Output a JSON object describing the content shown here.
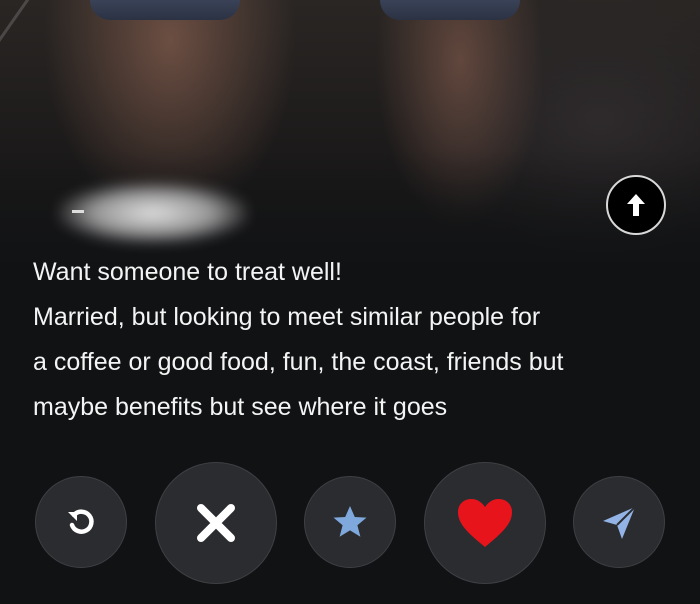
{
  "profile": {
    "name_redacted": true,
    "bio_lines": [
      "Want someone to treat well!",
      "Married,  but looking to meet similar people for",
      "a coffee or good food, fun, the coast, friends but",
      "maybe benefits but see where it goes"
    ]
  },
  "buttons": {
    "info": "arrow-up-icon",
    "rewind": "rewind-icon",
    "nope": "close-icon",
    "super_like": "star-icon",
    "like": "heart-icon",
    "boost": "send-arrow-icon"
  },
  "colors": {
    "nope": "#ffffff",
    "super_like": "#7fa8dd",
    "like": "#e8141c",
    "boost": "#93b3e6"
  }
}
